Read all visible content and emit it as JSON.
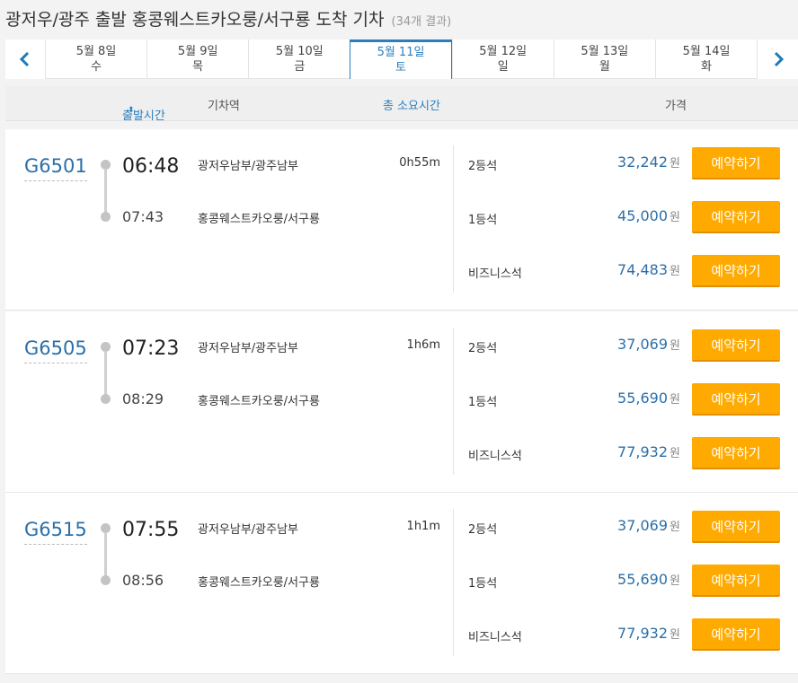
{
  "header": {
    "title": "광저우/광주 출발 홍콩웨스트카오룽/서구룡 도착 기차",
    "result_count": "(34개 결과)"
  },
  "date_nav": {
    "prev_icon": "chevron-left-icon",
    "next_icon": "chevron-right-icon",
    "dates": [
      {
        "date": "5월 8일",
        "weekday": "수",
        "active": false
      },
      {
        "date": "5월 9일",
        "weekday": "목",
        "active": false
      },
      {
        "date": "5월 10일",
        "weekday": "금",
        "active": false
      },
      {
        "date": "5월 11일",
        "weekday": "토",
        "active": true
      },
      {
        "date": "5월 12일",
        "weekday": "일",
        "active": false
      },
      {
        "date": "5월 13일",
        "weekday": "월",
        "active": false
      },
      {
        "date": "5월 14일",
        "weekday": "화",
        "active": false
      }
    ]
  },
  "columns": {
    "departure_time": "출발시간",
    "station": "기차역",
    "duration": "총 소요시간",
    "price": "가격"
  },
  "book_label": "예약하기",
  "currency": "원",
  "trains": [
    {
      "number": "G6501",
      "depart_time": "06:48",
      "arrive_time": "07:43",
      "from_station": "광저우남부/광주남부",
      "to_station": "홍콩웨스트카오룽/서구룡",
      "duration": "0h55m",
      "fares": [
        {
          "seat": "2등석",
          "price": "32,242"
        },
        {
          "seat": "1등석",
          "price": "45,000"
        },
        {
          "seat": "비즈니스석",
          "price": "74,483"
        }
      ]
    },
    {
      "number": "G6505",
      "depart_time": "07:23",
      "arrive_time": "08:29",
      "from_station": "광저우남부/광주남부",
      "to_station": "홍콩웨스트카오룽/서구룡",
      "duration": "1h6m",
      "fares": [
        {
          "seat": "2등석",
          "price": "37,069"
        },
        {
          "seat": "1등석",
          "price": "55,690"
        },
        {
          "seat": "비즈니스석",
          "price": "77,932"
        }
      ]
    },
    {
      "number": "G6515",
      "depart_time": "07:55",
      "arrive_time": "08:56",
      "from_station": "광저우남부/광주남부",
      "to_station": "홍콩웨스트카오룽/서구룡",
      "duration": "1h1m",
      "fares": [
        {
          "seat": "2등석",
          "price": "37,069"
        },
        {
          "seat": "1등석",
          "price": "55,690"
        },
        {
          "seat": "비즈니스석",
          "price": "77,932"
        }
      ]
    }
  ],
  "colors": {
    "accent": "#2b7fbf",
    "book_button": "#ffaa00",
    "price": "#2b6fa8"
  }
}
